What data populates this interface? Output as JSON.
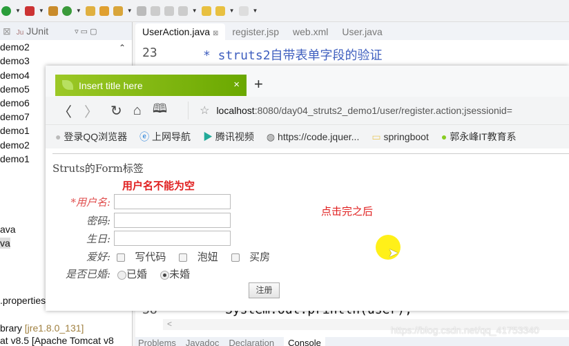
{
  "eclipse": {
    "left_tab": "JUnit",
    "tree": [
      "demo2",
      "demo3",
      "demo4",
      "demo5",
      "demo6",
      "demo7",
      "demo1",
      "demo2",
      "demo1",
      "ava",
      "va",
      ".properties",
      "brary",
      "[jre1.8.0_131]",
      "at v8.5 [Apache Tomcat v8"
    ],
    "editor_tabs": [
      "UserAction.java",
      "register.jsp",
      "web.xml",
      "User.java"
    ],
    "line_23": "23",
    "code_23": "* struts2自带表单字段的验证",
    "line_38": "38",
    "code_38": "System.out.println(user);",
    "bottom_tabs": [
      "Problems",
      "Javadoc",
      "Declaration",
      "Console"
    ]
  },
  "browser": {
    "tab_title": "Insert title here",
    "url_host": "localhost",
    "url_rest": ":8080/day04_struts2_demo1/user/register.action;jsessionid=",
    "bookmarks": [
      "登录QQ浏览器",
      "上网导航",
      "腾讯视频",
      "https://code.jquer...",
      "springboot",
      "郭永峰IT教育系"
    ]
  },
  "page": {
    "heading": "Struts的Form标签",
    "error": "用户名不能为空",
    "username_label": "*用户名:",
    "password_label": "密码:",
    "birthday_label": "生日:",
    "hobby_label": "爱好:",
    "hobbies": [
      "写代码",
      "泡妞",
      "买房"
    ],
    "married_label": "是否已婚:",
    "married_options": [
      "已婚",
      "未婚"
    ],
    "married_selected": "未婚",
    "submit": "注册"
  },
  "annotation": "点击完之后",
  "watermark": "https://blog.csdn.net/qq_41753340",
  "colors": {
    "tab_green": "#7ab800",
    "error_red": "#e02020",
    "cursor_highlight": "#ffee00"
  }
}
